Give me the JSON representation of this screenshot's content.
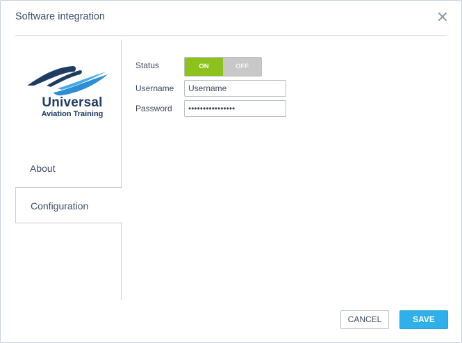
{
  "dialog": {
    "title": "Software integration"
  },
  "sidebar": {
    "logo": {
      "line1": "Universal",
      "line2": "Aviation Training"
    },
    "items": [
      {
        "label": "About"
      },
      {
        "label": "Configuration",
        "selected": true
      }
    ]
  },
  "form": {
    "status": {
      "label": "Status",
      "on_label": "ON",
      "off_label": "OFF",
      "value": "ON"
    },
    "username": {
      "label": "Username",
      "value": "Username"
    },
    "password": {
      "label": "Password",
      "value": "password12345678"
    }
  },
  "footer": {
    "cancel_label": "CANCEL",
    "save_label": "SAVE"
  },
  "colors": {
    "toggle_on": "#8cc21b",
    "toggle_off": "#c8c8c8",
    "save_button": "#2eb0ea",
    "title_text": "#3c4f66",
    "logo_navy": "#1f3c63",
    "logo_blue": "#2c8fd4"
  },
  "icons": {
    "close": "close-icon",
    "logo": "wing-logo-icon"
  }
}
